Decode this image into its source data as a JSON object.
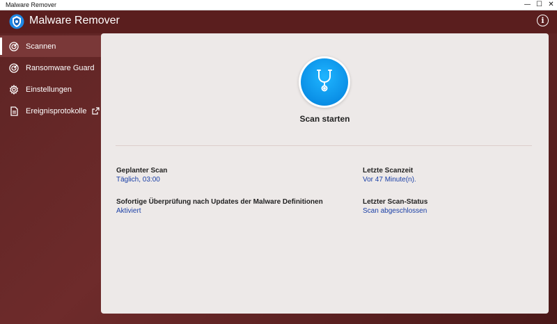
{
  "window": {
    "title": "Malware Remover",
    "minimize_glyph": "—",
    "maximize_glyph": "☐",
    "close_glyph": "✕"
  },
  "app": {
    "name": "Malware Remover",
    "info_glyph": "i",
    "accent_color": "#0a8fe6",
    "header_color": "#5a1e1e"
  },
  "sidebar": {
    "items": [
      {
        "label": "Scannen",
        "icon": "radar-icon",
        "active": true
      },
      {
        "label": "Ransomware Guard",
        "icon": "radar-icon",
        "active": false
      },
      {
        "label": "Einstellungen",
        "icon": "gear-icon",
        "active": false
      },
      {
        "label": "Ereignisprotokolle",
        "icon": "document-icon",
        "active": false,
        "external": true
      }
    ]
  },
  "main": {
    "scan_button_label": "Scan starten",
    "info": {
      "scheduled_title": "Geplanter Scan",
      "scheduled_value": "Täglich, 03:00",
      "last_time_title": "Letzte Scanzeit",
      "last_time_value": "Vor 47 Minute(n).",
      "instant_title": "Sofortige Überprüfung nach Updates der Malware Definitionen",
      "instant_value": "Aktiviert",
      "last_status_title": "Letzter Scan-Status",
      "last_status_value": "Scan abgeschlossen"
    }
  }
}
